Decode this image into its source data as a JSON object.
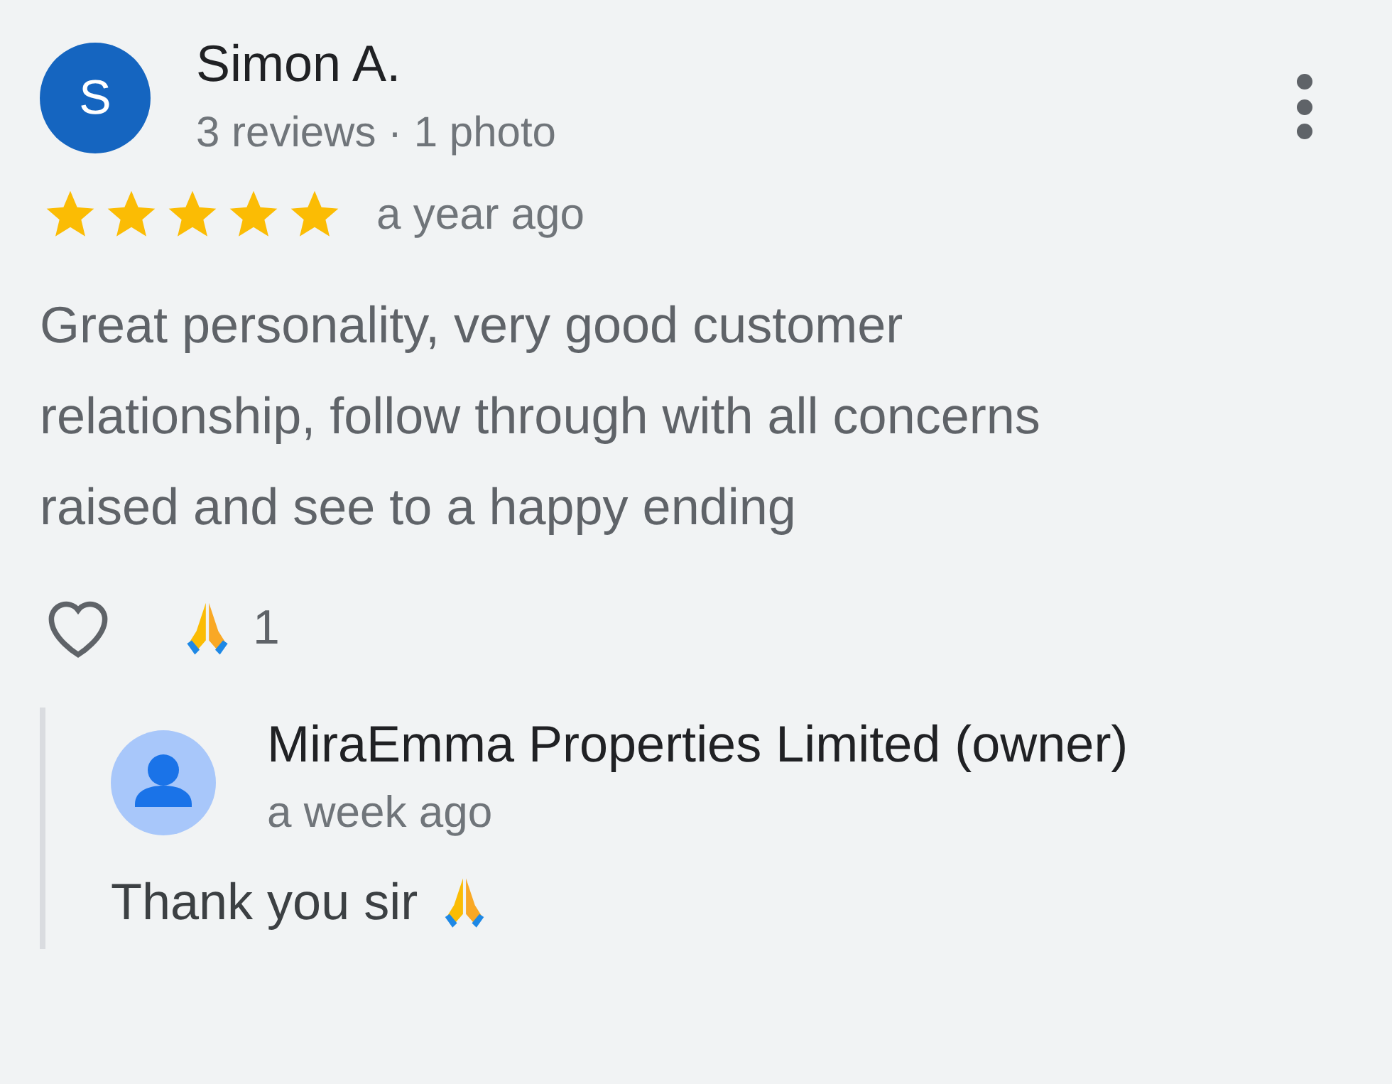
{
  "review": {
    "avatar_letter": "S",
    "author": "Simon A.",
    "meta": "3 reviews · 1 photo",
    "stars": 5,
    "time": "a year ago",
    "text": "Great personality, very good customer relationship, follow through with all concerns raised and see to a happy ending",
    "liked": false,
    "reaction_count": "1"
  },
  "reply": {
    "author": "MiraEmma Properties Limited (owner)",
    "time": "a week ago",
    "text": "Thank you sir"
  }
}
